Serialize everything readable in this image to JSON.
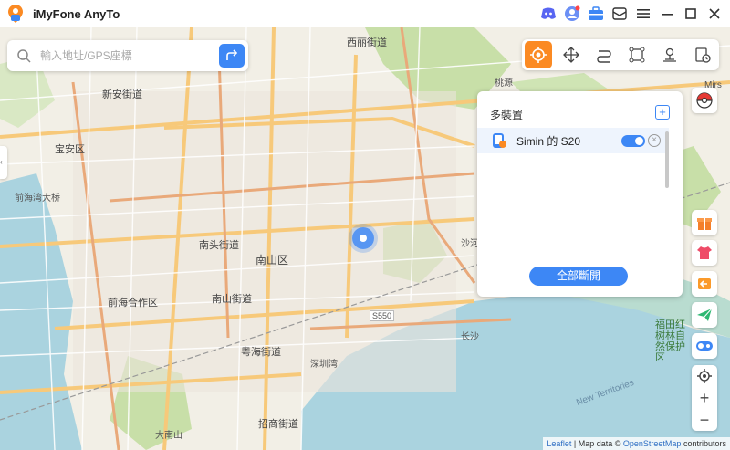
{
  "app": {
    "title": "iMyFone AnyTo"
  },
  "search": {
    "placeholder": "輸入地址/GPS座標",
    "value": ""
  },
  "panel": {
    "title": "多裝置",
    "device_name": "Simin 的 S20",
    "disconnect_label": "全部斷開"
  },
  "map_labels": [
    {
      "text": "西丽街道",
      "cls": "district"
    },
    {
      "text": "新安街道",
      "cls": "district"
    },
    {
      "text": "宝安区",
      "cls": "district"
    },
    {
      "text": "前海湾大桥",
      "cls": ""
    },
    {
      "text": "南头街道",
      "cls": "district"
    },
    {
      "text": "南山区",
      "cls": "district"
    },
    {
      "text": "前海合作区",
      "cls": "district"
    },
    {
      "text": "南山街道",
      "cls": "district"
    },
    {
      "text": "粤海街道",
      "cls": "district"
    },
    {
      "text": "招商街道",
      "cls": "district"
    },
    {
      "text": "沙河",
      "cls": ""
    },
    {
      "text": "福田红树林自然保护区",
      "cls": "district"
    },
    {
      "text": "深圳湾",
      "cls": ""
    },
    {
      "text": "Mirs",
      "cls": ""
    },
    {
      "text": "桃源",
      "cls": ""
    },
    {
      "text": "S550",
      "cls": ""
    },
    {
      "text": "长沙",
      "cls": ""
    },
    {
      "text": "大南山",
      "cls": ""
    },
    {
      "text": "New Territories",
      "cls": ""
    }
  ],
  "attribution": {
    "leaflet": "Leaflet",
    "mapdata": "Map data ©",
    "osm": "OpenStreetMap",
    "contrib": "contributors"
  },
  "colors": {
    "accent": "#3d87f5",
    "mode_active": "#fb8a23"
  }
}
